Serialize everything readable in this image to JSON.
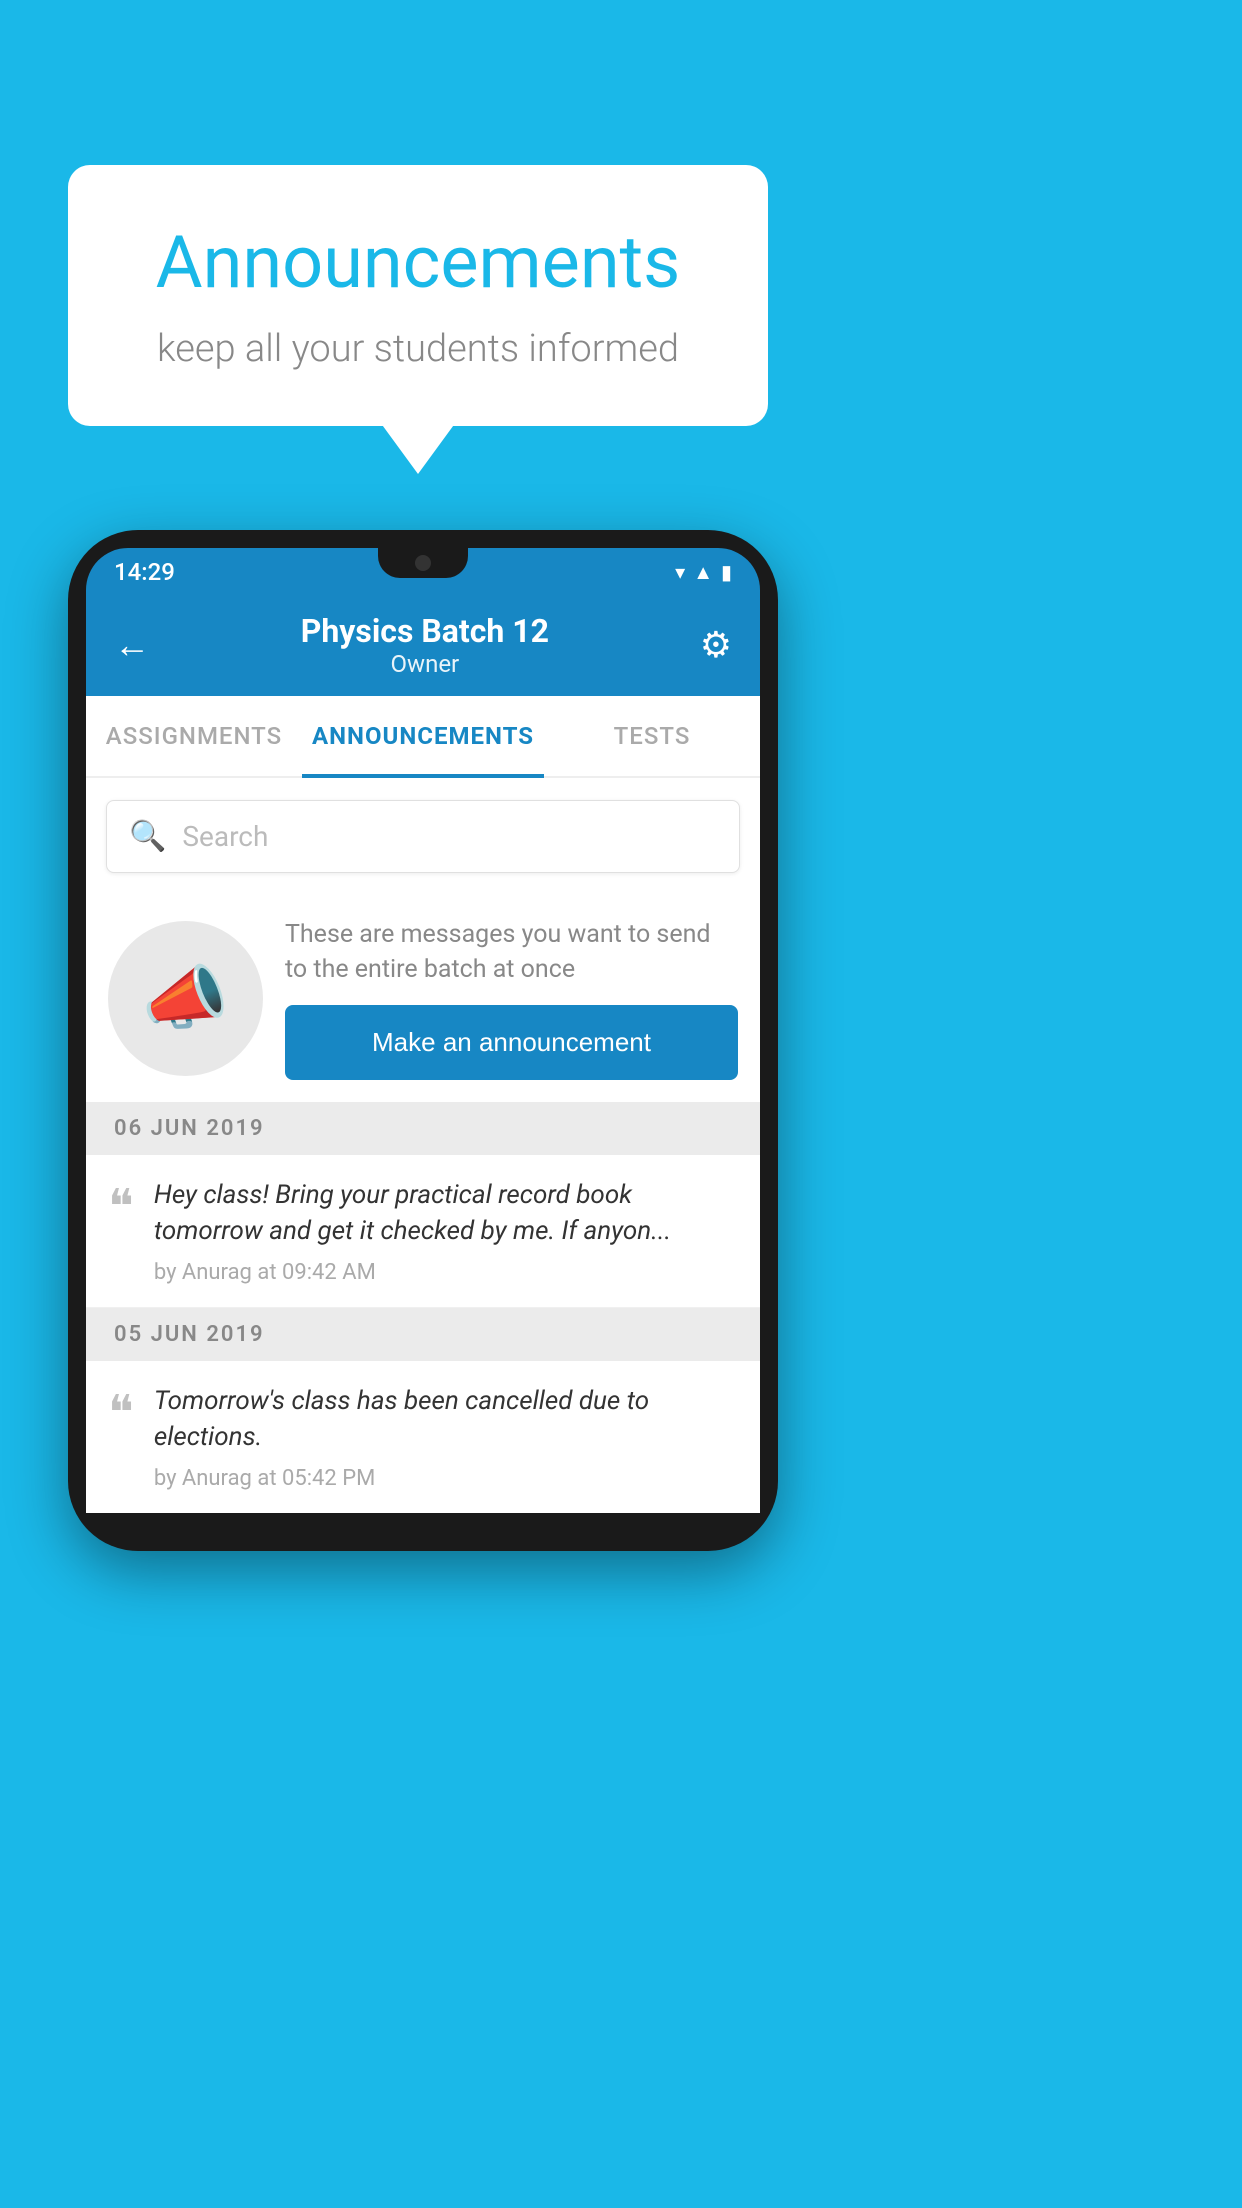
{
  "background_color": "#1ab8e8",
  "speech_bubble": {
    "title": "Announcements",
    "subtitle": "keep all your students informed"
  },
  "phone": {
    "status_bar": {
      "time": "14:29"
    },
    "app_bar": {
      "title": "Physics Batch 12",
      "subtitle": "Owner",
      "back_label": "←",
      "gear_label": "⚙"
    },
    "tabs": [
      {
        "label": "ASSIGNMENTS",
        "active": false
      },
      {
        "label": "ANNOUNCEMENTS",
        "active": true
      },
      {
        "label": "TESTS",
        "active": false
      },
      {
        "label": "·",
        "active": false
      }
    ],
    "search": {
      "placeholder": "Search"
    },
    "promo": {
      "description": "These are messages you want to send to the entire batch at once",
      "button_label": "Make an announcement"
    },
    "announcements": [
      {
        "date": "06  JUN  2019",
        "message": "Hey class! Bring your practical record book tomorrow and get it checked by me. If anyon...",
        "meta": "by Anurag at 09:42 AM"
      },
      {
        "date": "05  JUN  2019",
        "message": "Tomorrow's class has been cancelled due to elections.",
        "meta": "by Anurag at 05:42 PM"
      }
    ]
  }
}
